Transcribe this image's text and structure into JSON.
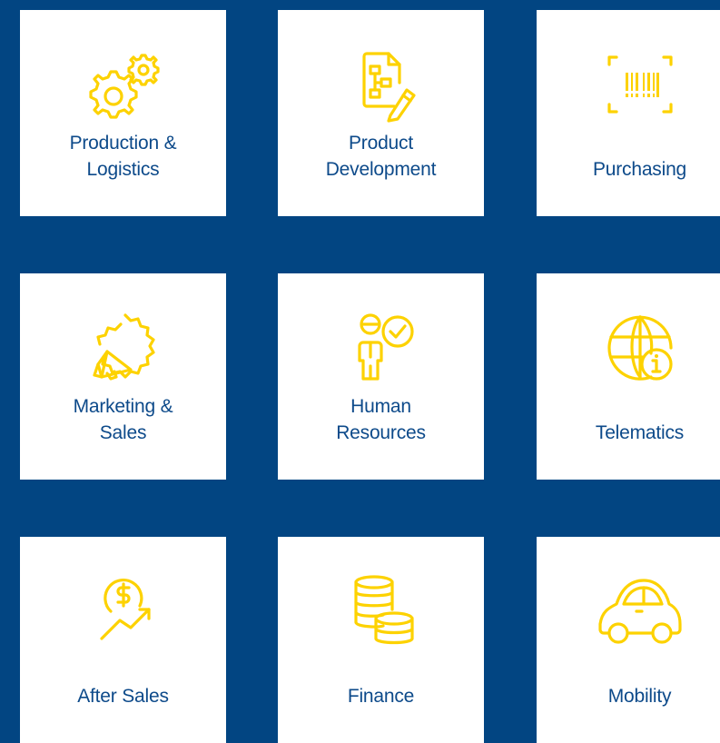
{
  "accent_color": "#fdd200",
  "background_color": "#024582",
  "tiles": [
    {
      "label": "Production &\nLogistics",
      "icon": "gears-icon"
    },
    {
      "label": "Product\nDevelopment",
      "icon": "document-edit-icon"
    },
    {
      "label": "Purchasing",
      "icon": "barcode-scan-icon"
    },
    {
      "label": "Marketing &\nSales",
      "icon": "megaphone-icon"
    },
    {
      "label": "Human\nResources",
      "icon": "person-check-icon"
    },
    {
      "label": "Telematics",
      "icon": "globe-info-icon"
    },
    {
      "label": "After Sales",
      "icon": "dollar-growth-icon"
    },
    {
      "label": "Finance",
      "icon": "coins-icon"
    },
    {
      "label": "Mobility",
      "icon": "car-icon"
    }
  ]
}
